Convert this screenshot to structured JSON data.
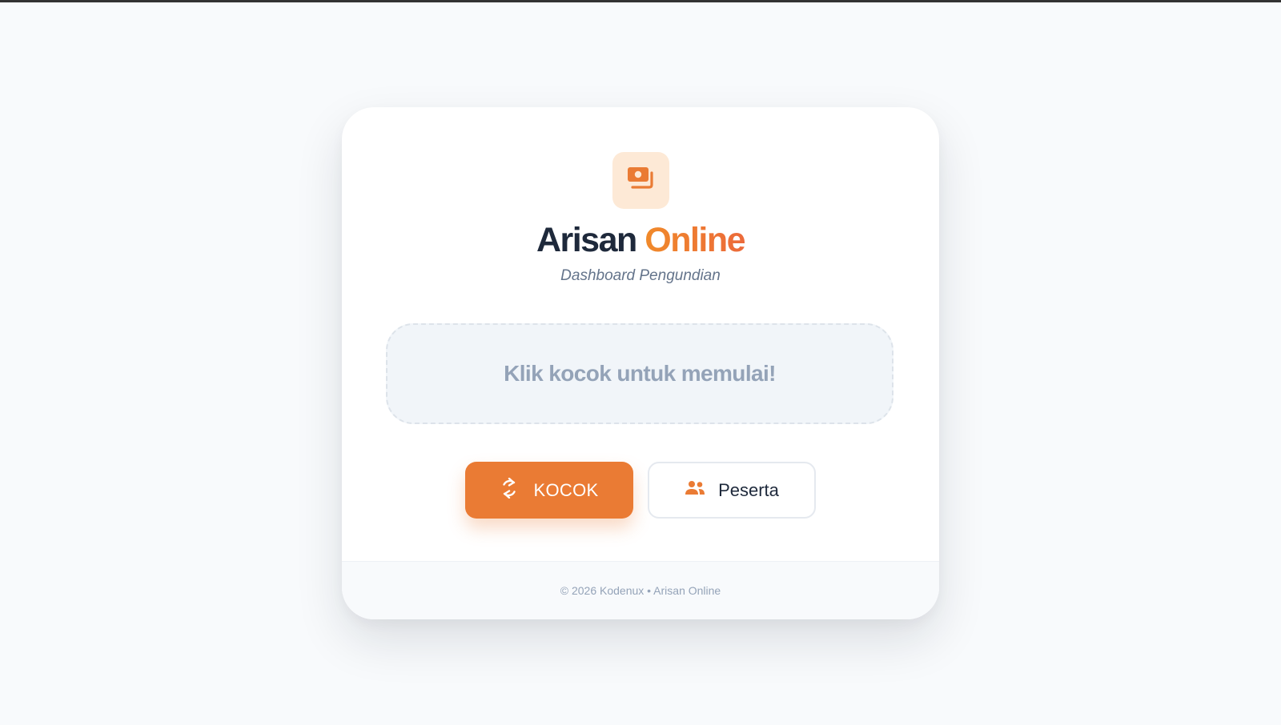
{
  "brand": {
    "title_main": "Arisan",
    "title_accent": "Online",
    "subtitle": "Dashboard Pengundian",
    "logo_icon": "money-stack-icon",
    "accent_color": "#ea7b34"
  },
  "result": {
    "message": "Klik kocok untuk memulai!"
  },
  "actions": {
    "shuffle_label": "KOCOK",
    "shuffle_icon": "refresh-icon",
    "participants_label": "Peserta",
    "participants_icon": "users-icon"
  },
  "footer": {
    "text": "© 2026 Kodenux • Arisan Online"
  }
}
